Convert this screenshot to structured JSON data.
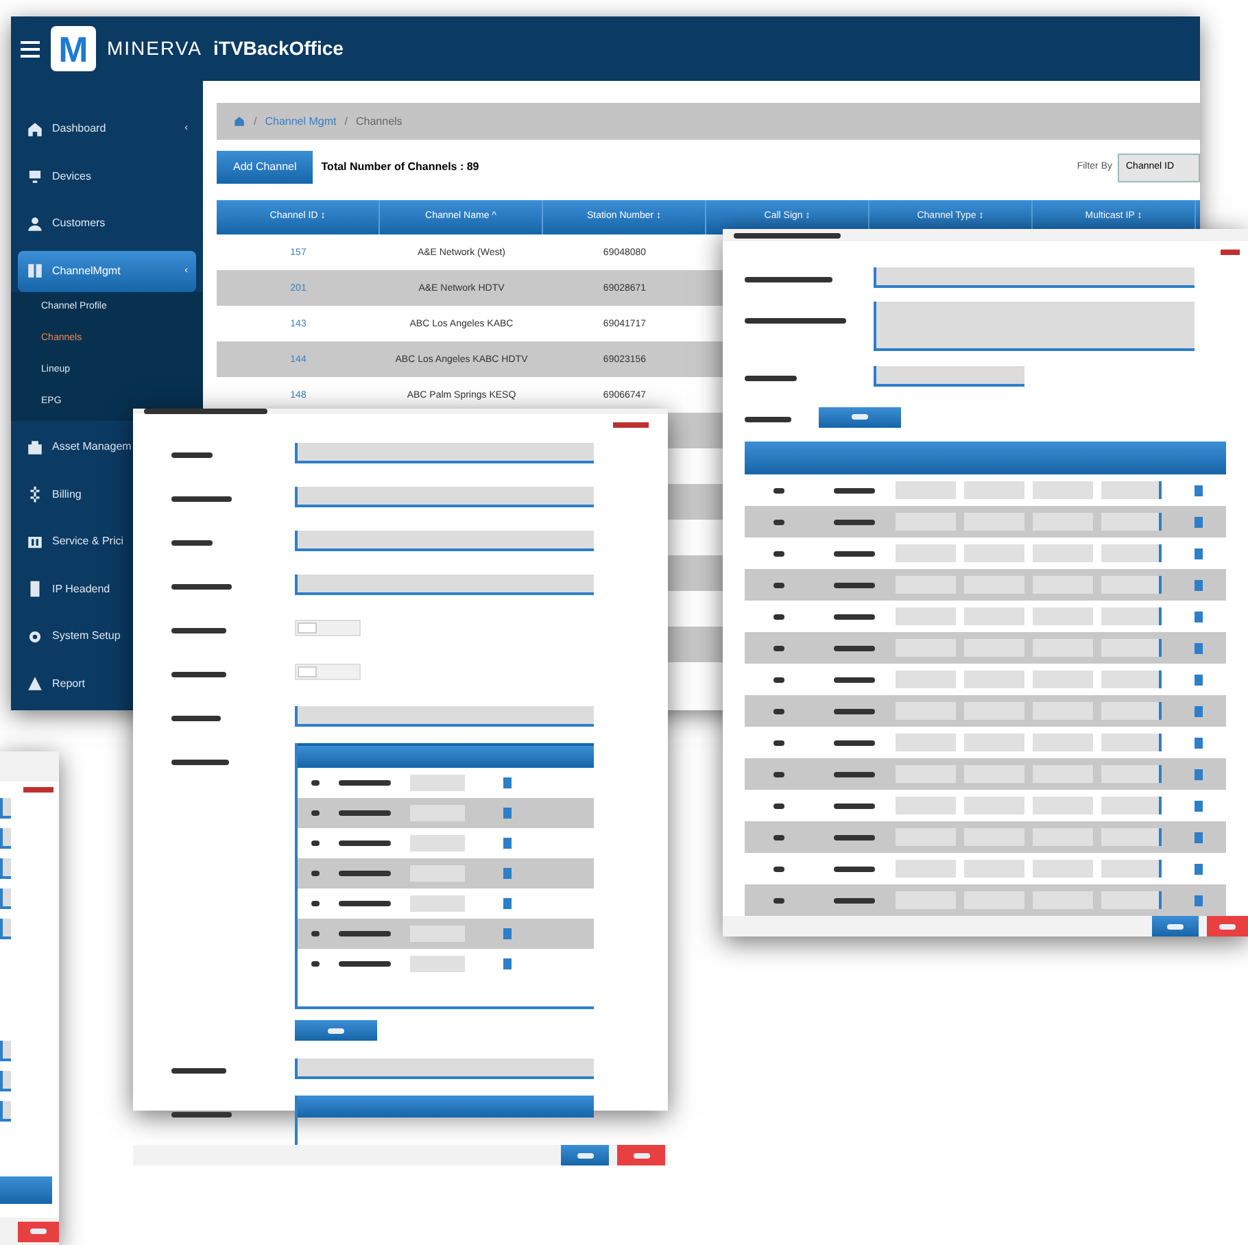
{
  "app": {
    "logo_letter": "M",
    "brand": "MINERVA",
    "product": "iTVBackOffice"
  },
  "sidebar": {
    "items": [
      {
        "label": "Dashboard",
        "selected": false,
        "caret": "‹"
      },
      {
        "label": "Devices",
        "selected": false
      },
      {
        "label": "Customers",
        "selected": false
      },
      {
        "label": "ChannelMgmt",
        "selected": true,
        "caret": "‹",
        "children": [
          {
            "label": "Channel Profile",
            "selected": false
          },
          {
            "label": "Channels",
            "selected": true
          },
          {
            "label": "Lineup",
            "selected": false
          },
          {
            "label": "EPG",
            "selected": false
          }
        ]
      },
      {
        "label": "Asset Managem",
        "selected": false
      },
      {
        "label": "Billing",
        "selected": false
      },
      {
        "label": "Service & Prici",
        "selected": false
      },
      {
        "label": "IP Headend",
        "selected": false
      },
      {
        "label": "System Setup",
        "selected": false
      },
      {
        "label": "Report",
        "selected": false
      }
    ]
  },
  "breadcrumb": [
    {
      "separator": "/",
      "label": "Channel Mgmt"
    },
    {
      "separator": "/",
      "label": "Channels"
    }
  ],
  "dialog_toggles": [
    {
      "on": false
    },
    {
      "on": false
    }
  ],
  "toolbar": {
    "add_button": "Add Channel",
    "total": "Total Number of Channels : 89",
    "filter_label": "Filter By",
    "filter_value": "Channel ID"
  },
  "table": {
    "columns": [
      "Channel ID ↕",
      "Channel Name ^",
      "Station Number ↕",
      "Call Sign ↕",
      "Channel Type ↕",
      "Multicast IP ↕"
    ],
    "rows": [
      [
        "157",
        "A&E Network (West)",
        "69048080"
      ],
      [
        "201",
        "A&E Network HDTV",
        "69028671"
      ],
      [
        "143",
        "ABC Los Angeles KABC",
        "69041717"
      ],
      [
        "144",
        "ABC Los Angeles KABC HDTV",
        "69023156"
      ],
      [
        "148",
        "ABC Palm Springs KESQ",
        "69066747"
      ]
    ]
  }
}
